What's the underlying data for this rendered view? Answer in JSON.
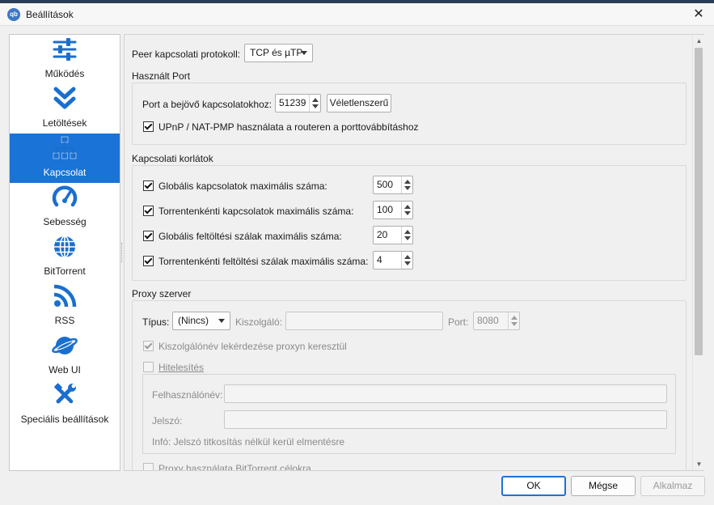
{
  "window": {
    "title": "Beállítások",
    "app_icon_text": "qb",
    "close_glyph": "✕"
  },
  "colors": {
    "accent": "#1a73d6",
    "icon": "#1a6fce",
    "selected_text": "#ffffff"
  },
  "sidebar": {
    "items": [
      {
        "label": "Működés",
        "icon": "sliders-icon"
      },
      {
        "label": "Letöltések",
        "icon": "double-chevron-down-icon"
      },
      {
        "label": "Kapcsolat",
        "icon": "network-icon",
        "selected": true
      },
      {
        "label": "Sebesség",
        "icon": "speedometer-icon"
      },
      {
        "label": "BitTorrent",
        "icon": "globe-icon"
      },
      {
        "label": "RSS",
        "icon": "rss-icon"
      },
      {
        "label": "Web UI",
        "icon": "planet-icon"
      },
      {
        "label": "Speciális beállítások",
        "icon": "tools-icon"
      }
    ]
  },
  "connection": {
    "protocol_label": "Peer kapcsolati protokoll:",
    "protocol_value": "TCP és µTP",
    "port_group_title": "Használt Port",
    "port_label": "Port a bejövő kapcsolatokhoz:",
    "port_value": "51239",
    "random_button": "Véletlenszerű",
    "upnp_label": "UPnP / NAT-PMP használata a routeren a porttovábbításhoz",
    "upnp_checked": true,
    "limits_group_title": "Kapcsolati korlátok",
    "limits": [
      {
        "label": "Globális kapcsolatok maximális száma:",
        "value": "500",
        "checked": true
      },
      {
        "label": "Torrentenkénti kapcsolatok maximális száma:",
        "value": "100",
        "checked": true
      },
      {
        "label": "Globális feltöltési szálak maximális száma:",
        "value": "20",
        "checked": true
      },
      {
        "label": "Torrentenkénti feltöltési szálak maximális száma:",
        "value": "4",
        "checked": true
      }
    ]
  },
  "proxy": {
    "group_title": "Proxy szerver",
    "type_label": "Típus:",
    "type_value": "(Nincs)",
    "server_label": "Kiszolgáló:",
    "server_value": "",
    "port_label": "Port:",
    "port_value": "8080",
    "hostname_lookup_label": "Kiszolgálónév lekérdezése proxyn keresztül",
    "hostname_lookup_checked": true,
    "auth_label": "Hitelesítés",
    "auth_checked": false,
    "username_label": "Felhasználónév:",
    "password_label": "Jelszó:",
    "info_text": "Infó: Jelszó titkosítás nélkül kerül elmentésre",
    "bittorrent_label": "Proxy használata BitTorrent célokra",
    "bittorrent_checked": false
  },
  "buttons": {
    "ok": "OK",
    "cancel": "Mégse",
    "apply": "Alkalmaz"
  }
}
